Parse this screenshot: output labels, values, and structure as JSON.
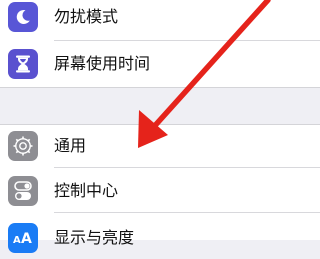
{
  "settings": {
    "group1": [
      {
        "label": "勿扰模式",
        "icon": "moon-icon",
        "color": "#5856d6"
      },
      {
        "label": "屏幕使用时间",
        "icon": "hourglass-icon",
        "color": "#5a51cf"
      }
    ],
    "group2": [
      {
        "label": "通用",
        "icon": "gear-icon",
        "color": "#8e8e93"
      },
      {
        "label": "控制中心",
        "icon": "toggle-icon",
        "color": "#8e8e93"
      },
      {
        "label": "显示与亮度",
        "icon": "text-size-icon",
        "color": "#1a7cf5"
      }
    ]
  },
  "annotation": {
    "arrow_color": "#e5231b",
    "icon": "red-arrow-icon"
  }
}
